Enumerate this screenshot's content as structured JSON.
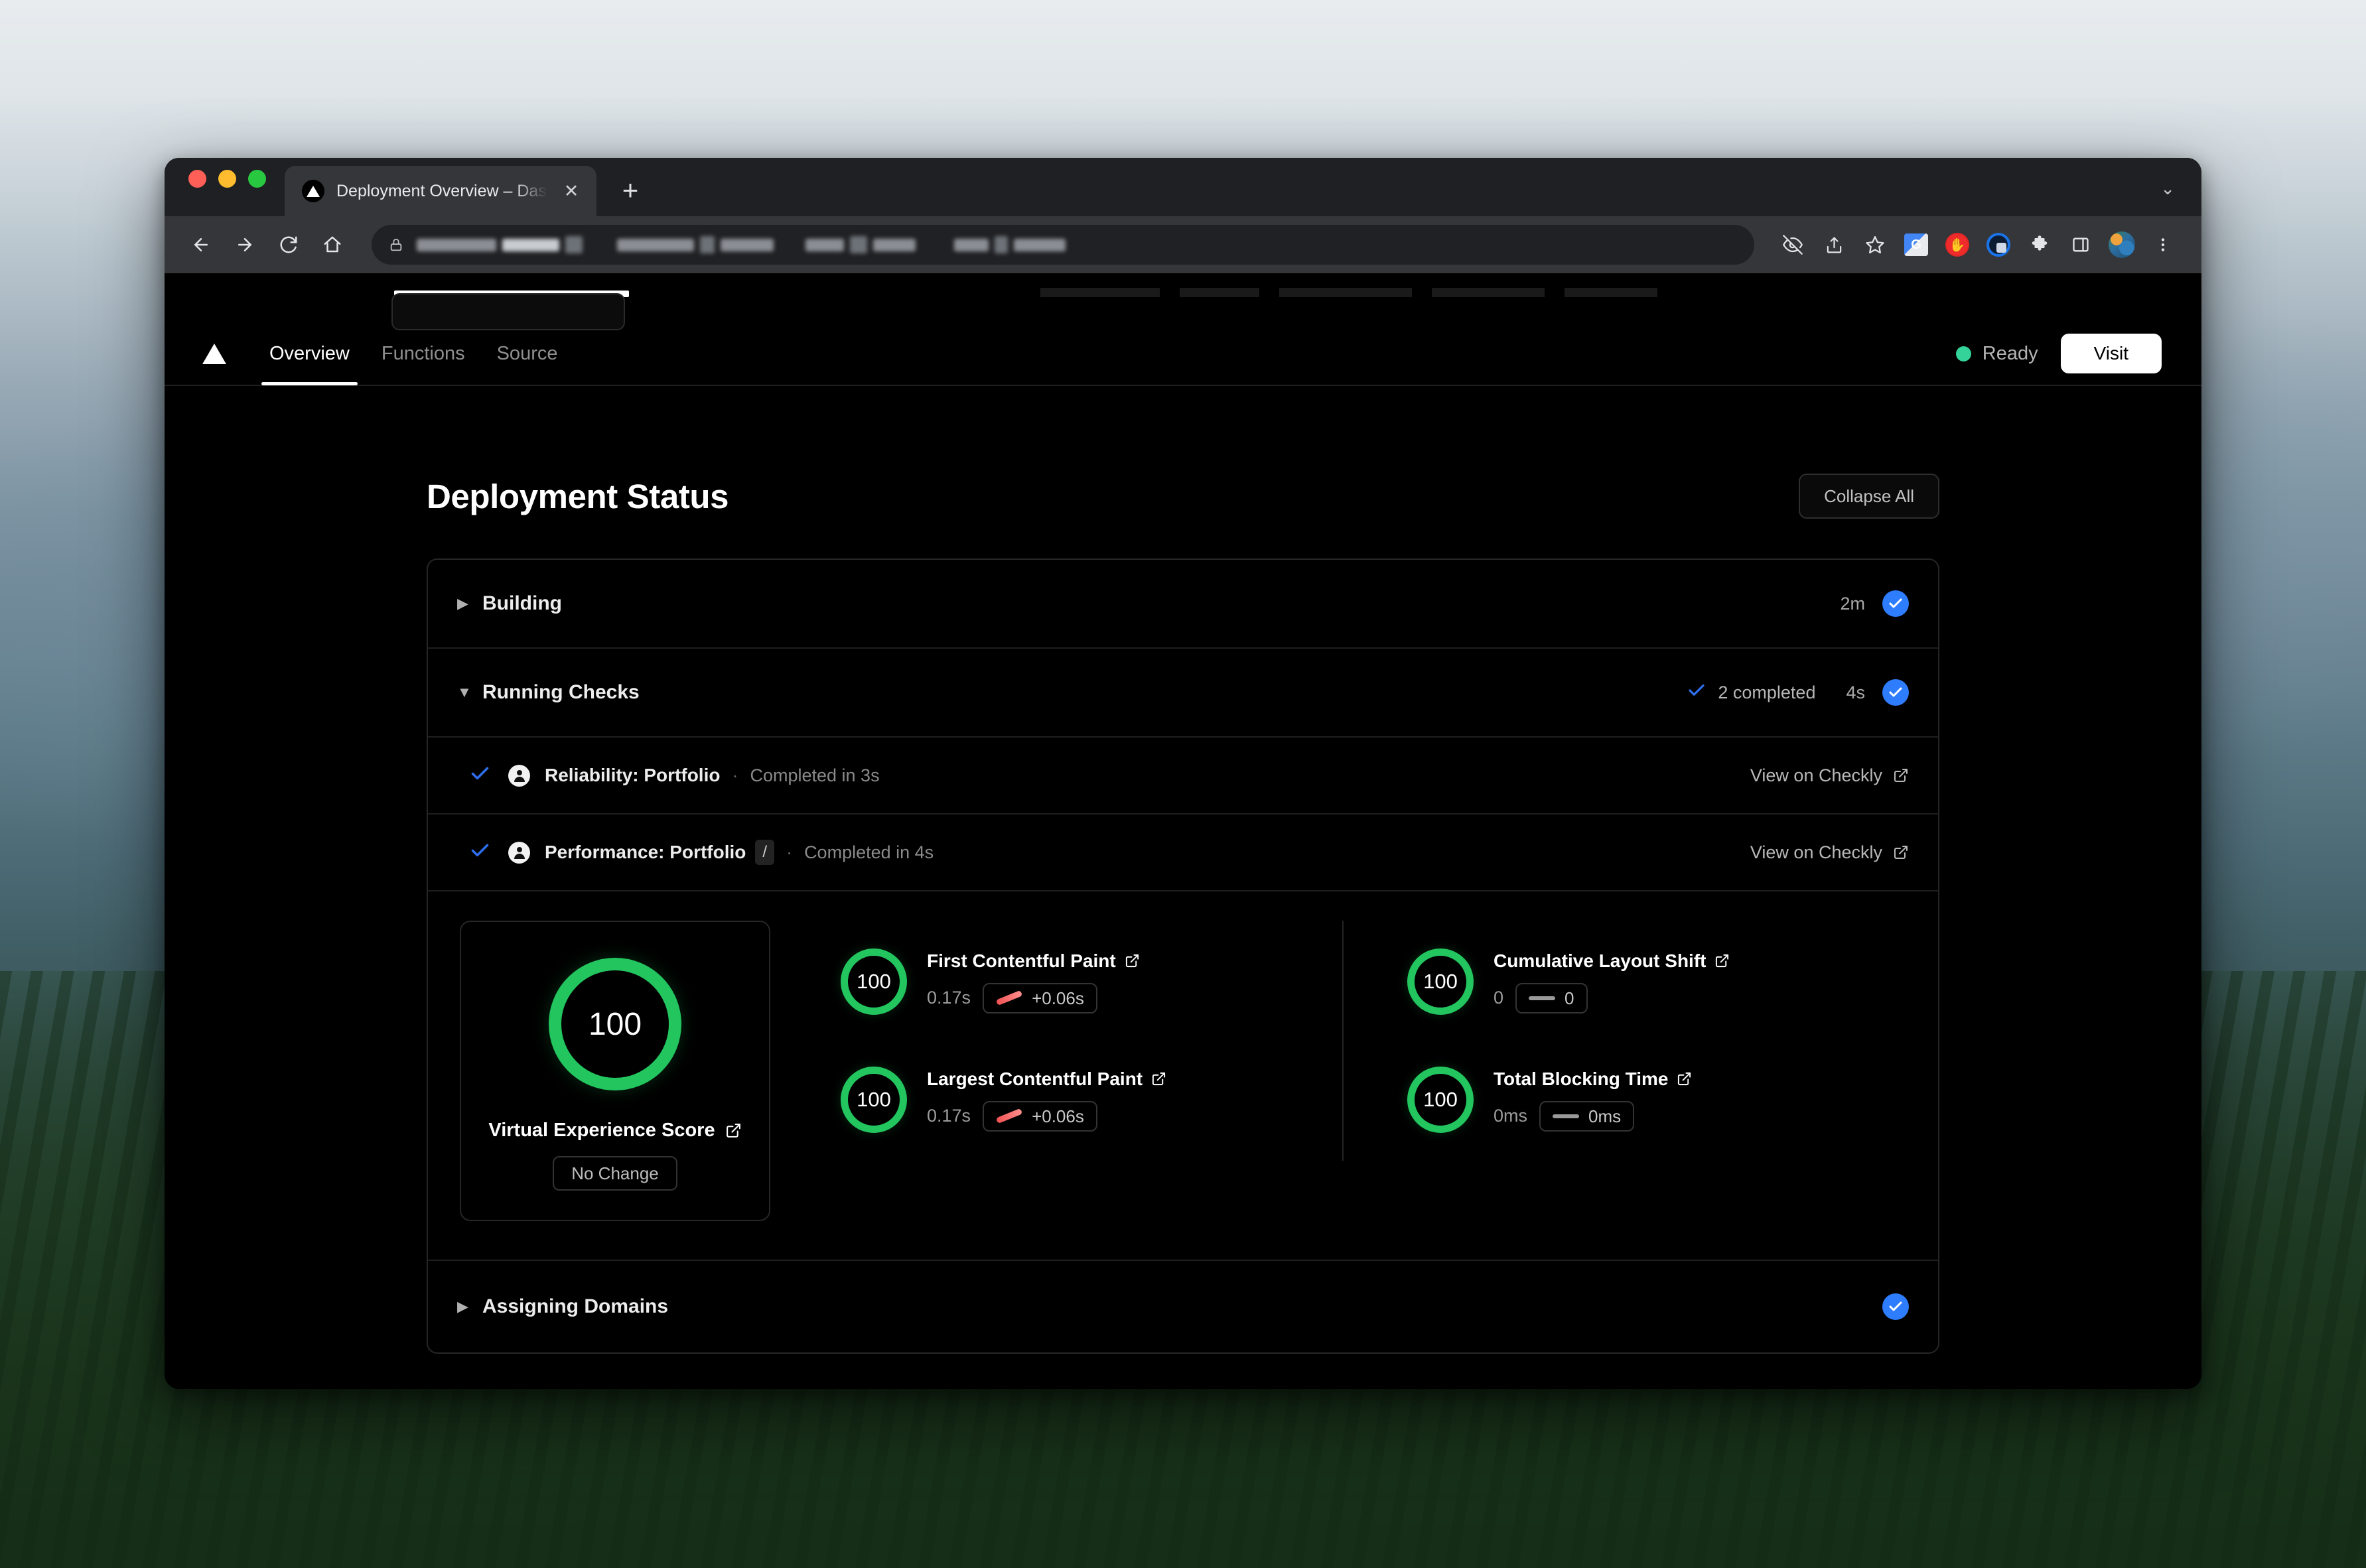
{
  "browser": {
    "tab": {
      "title": "Deployment Overview – Dashb",
      "favicon_icon": "triangle-logo-icon",
      "close_icon": "close-icon"
    },
    "new_tab_label": "+",
    "window_chevron": "⌄",
    "nav": {
      "back_icon": "back-arrow-icon",
      "forward_icon": "forward-arrow-icon",
      "reload_icon": "reload-icon",
      "home_icon": "home-icon"
    },
    "omnibox": {
      "lock_icon": "lock-icon",
      "url_value": ""
    },
    "toolbar_icons": [
      "eye-off-icon",
      "share-icon",
      "bookmark-star-icon",
      "google-translate-extension-icon",
      "adblock-extension-icon",
      "privacy-badger-extension-icon",
      "extensions-puzzle-icon",
      "side-panel-icon",
      "profile-avatar",
      "three-dot-menu-icon"
    ]
  },
  "app": {
    "logo_icon": "vercel-triangle-logo-icon",
    "tabs": [
      {
        "label": "Overview",
        "active": true
      },
      {
        "label": "Functions",
        "active": false
      },
      {
        "label": "Source",
        "active": false
      }
    ],
    "status": {
      "label": "Ready",
      "dot_color": "#34d399"
    },
    "visit_label": "Visit"
  },
  "section": {
    "title": "Deployment Status",
    "collapse_label": "Collapse All"
  },
  "status_rows": {
    "building": {
      "caret": "▶",
      "label": "Building",
      "duration": "2m",
      "badge_icon": "check-circle-icon"
    },
    "running_checks": {
      "caret": "▼",
      "label": "Running Checks",
      "completed_text": "2 completed",
      "completed_icon": "check-icon",
      "duration": "4s",
      "badge_icon": "check-circle-icon"
    },
    "assigning_domains": {
      "caret": "▶",
      "label": "Assigning Domains",
      "badge_icon": "check-circle-icon"
    }
  },
  "checks": [
    {
      "tick_icon": "check-icon",
      "avatar_icon": "checkly-avatar-icon",
      "name": "Reliability: Portfolio",
      "path_badge": "",
      "separator": "·",
      "meta": "Completed in 3s",
      "link_label": "View on Checkly",
      "link_icon": "external-link-icon"
    },
    {
      "tick_icon": "check-icon",
      "avatar_icon": "checkly-avatar-icon",
      "name": "Performance: Portfolio",
      "path_badge": "/",
      "separator": "·",
      "meta": "Completed in 4s",
      "link_label": "View on Checkly",
      "link_icon": "external-link-icon"
    }
  ],
  "performance": {
    "ves": {
      "score": "100",
      "label": "Virtual Experience Score",
      "link_icon": "external-link-icon",
      "change_label": "No Change",
      "ring_color": "#22c55e"
    },
    "metrics": [
      {
        "score": "100",
        "title": "First Contentful Paint",
        "link_icon": "external-link-icon",
        "value": "0.17s",
        "delta": "+0.06s",
        "trend": "up",
        "trend_color": "#f05252",
        "column": "left"
      },
      {
        "score": "100",
        "title": "Largest Contentful Paint",
        "link_icon": "external-link-icon",
        "value": "0.17s",
        "delta": "+0.06s",
        "trend": "up",
        "trend_color": "#f05252",
        "column": "left"
      },
      {
        "score": "100",
        "title": "Cumulative Layout Shift",
        "link_icon": "external-link-icon",
        "value": "0",
        "delta": "0",
        "trend": "flat",
        "trend_color": "#9a9a9a",
        "column": "right"
      },
      {
        "score": "100",
        "title": "Total Blocking Time",
        "link_icon": "external-link-icon",
        "value": "0ms",
        "delta": "0ms",
        "trend": "flat",
        "trend_color": "#9a9a9a",
        "column": "right"
      }
    ]
  }
}
